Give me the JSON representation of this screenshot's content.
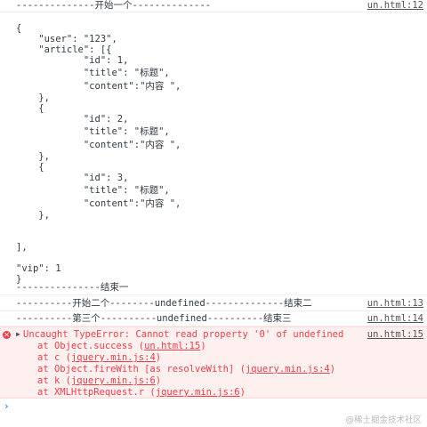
{
  "logs": [
    {
      "message": "--------------开始一个--------------",
      "source": "un.html:12"
    },
    {
      "message": "---------------结束一",
      "source": ""
    },
    {
      "message": "----------开始二个--------undefined--------------结束二",
      "source": "un.html:13"
    },
    {
      "message": "----------第三个----------undefined----------结束三",
      "source": "un.html:14"
    }
  ],
  "json_text": "{\n    \"user\": \"123\",\n    \"article\": [{\n            \"id\": 1,\n            \"title\": \"标题\",\n            \"content\":\"内容 \",\n    },\n    {\n            \"id\": 2,\n            \"title\": \"标题\",\n            \"content\":\"内容 \",\n    },\n    {\n            \"id\": 3,\n            \"title\": \"标题\",\n            \"content\":\"内容 \",\n    },\n\n\n],\n\n\"vip\": 1\n}",
  "error": {
    "message": "Uncaught TypeError: Cannot read property '0' of undefined",
    "source": "un.html:15",
    "stack": [
      {
        "prefix": "at Object.success (",
        "link": "un.html:15",
        "suffix": ")"
      },
      {
        "prefix": "at c (",
        "link": "jquery.min.js:4",
        "suffix": ")"
      },
      {
        "prefix": "at Object.fireWith [as resolveWith] (",
        "link": "jquery.min.js:4",
        "suffix": ")"
      },
      {
        "prefix": "at k (",
        "link": "jquery.min.js:6",
        "suffix": ")"
      },
      {
        "prefix": "at XMLHttpRequest.r (",
        "link": "jquery.min.js:6",
        "suffix": ")"
      }
    ]
  },
  "prompt_symbol": "›",
  "watermark": "@稀土掘金技术社区",
  "colors": {
    "error": "#e8404a",
    "error_bg": "#fff0f0",
    "prompt": "#1a73e8"
  }
}
